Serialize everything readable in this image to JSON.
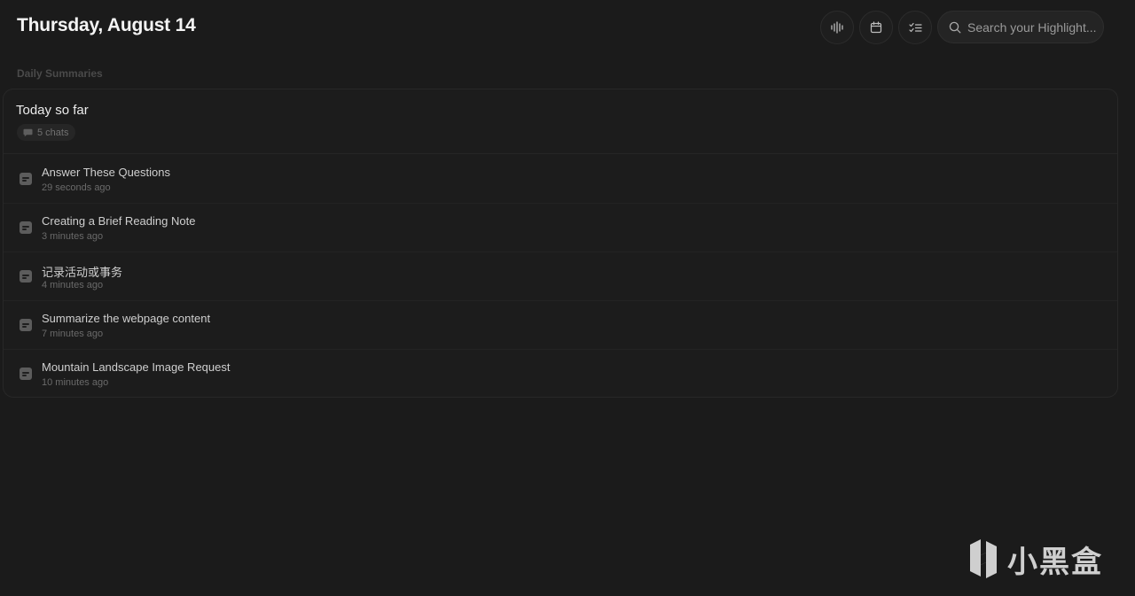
{
  "header": {
    "date": "Thursday, August 14",
    "search_placeholder": "Search your Highlight..."
  },
  "section": {
    "label": "Daily Summaries"
  },
  "card": {
    "title": "Today so far",
    "chats_count_label": "5 chats",
    "items": [
      {
        "title": "Answer These Questions",
        "time": "29 seconds ago"
      },
      {
        "title": "Creating a Brief Reading Note",
        "time": "3 minutes ago"
      },
      {
        "title": "记录活动或事务",
        "time": "4 minutes ago"
      },
      {
        "title": "Summarize the webpage content",
        "time": "7 minutes ago"
      },
      {
        "title": "Mountain Landscape Image Request",
        "time": "10 minutes ago"
      }
    ]
  },
  "watermark": {
    "text": "小黑盒"
  },
  "icons": {
    "audio": "audio-waveform-icon",
    "calendar": "calendar-icon",
    "tasks": "checklist-icon",
    "search": "search-icon",
    "chat": "chat-bubble-icon",
    "note": "note-icon",
    "logo": "xiaoheihe-logo-icon"
  },
  "colors": {
    "background": "#1b1b1b",
    "card_border": "#282828",
    "text_primary": "#ececec",
    "text_muted": "#6a6a6a"
  }
}
